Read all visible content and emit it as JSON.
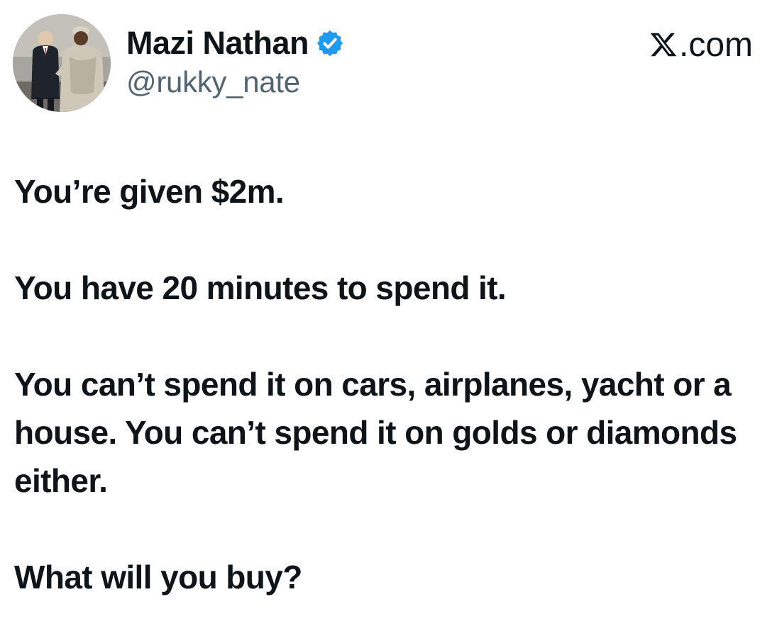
{
  "author": {
    "display_name": "Mazi Nathan",
    "handle": "@rukky_nate",
    "verified_badge_icon": "verified-badge-icon",
    "avatar_icon": "profile-photo"
  },
  "brand": {
    "logo_icon": "x-logo-icon",
    "label": ".com"
  },
  "tweet": {
    "paragraphs": [
      "You’re given $2m.",
      "You have 20 minutes to spend it.",
      "You can’t spend it on cars, airplanes, yacht or a house. You can’t spend it on golds or diamonds either.",
      "What will you buy?"
    ]
  },
  "colors": {
    "text": "#0f1419",
    "secondary_text": "#536471",
    "verified_blue": "#1d9bf0",
    "background": "#ffffff"
  }
}
